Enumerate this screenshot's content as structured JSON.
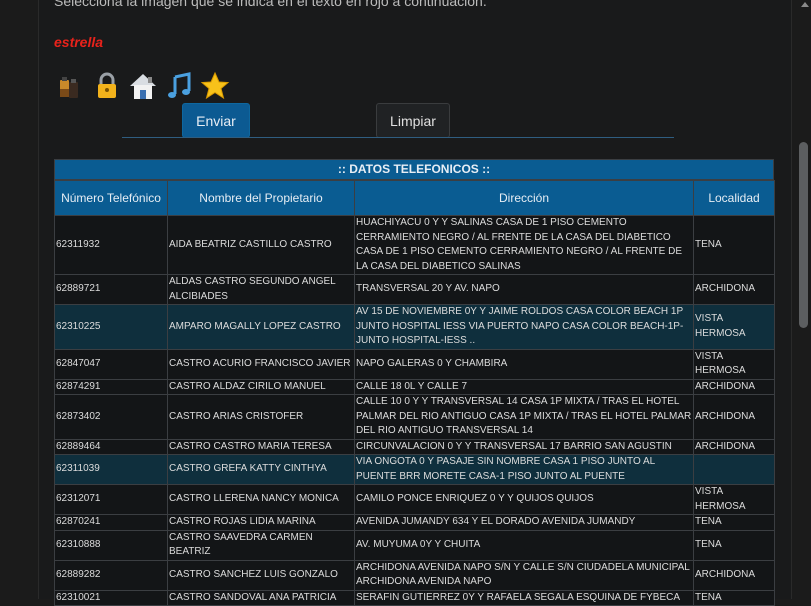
{
  "instruction": "Selecciona la imagen que se indica en el texto en rojo a continuación.",
  "target_word": "estrella",
  "icons": [
    "battery-icon",
    "lock-icon",
    "house-icon",
    "music-note-icon",
    "star-icon"
  ],
  "buttons": {
    "send": "Enviar",
    "clear": "Limpiar"
  },
  "table": {
    "title": ":: DATOS TELEFONICOS ::",
    "headers": [
      "Número Telefónico",
      "Nombre del Propietario",
      "Dirección",
      "Localidad"
    ],
    "rows": [
      [
        "62311932",
        "AIDA BEATRIZ CASTILLO CASTRO",
        "HUACHIYACU 0 Y Y SALINAS CASA DE 1 PISO CEMENTO CERRAMIENTO NEGRO / AL FRENTE DE LA CASA DEL DIABETICO CASA DE 1 PISO CEMENTO CERRAMIENTO NEGRO / AL FRENTE DE LA CASA DEL DIABETICO SALINAS",
        "TENA"
      ],
      [
        "62889721",
        "ALDAS CASTRO SEGUNDO ANGEL ALCIBIADES",
        "TRANSVERSAL 20 Y AV. NAPO",
        "ARCHIDONA"
      ],
      [
        "62310225",
        "AMPARO MAGALLY LOPEZ CASTRO",
        "AV 15 DE NOVIEMBRE 0Y Y JAIME ROLDOS CASA COLOR BEACH 1P JUNTO HOSPITAL IESS VIA PUERTO NAPO CASA COLOR BEACH-1P-JUNTO HOSPITAL-IESS ..",
        "VISTA HERMOSA"
      ],
      [
        "62847047",
        "CASTRO ACURIO FRANCISCO JAVIER",
        "NAPO GALERAS 0 Y CHAMBIRA",
        "VISTA HERMOSA"
      ],
      [
        "62874291",
        "CASTRO ALDAZ CIRILO MANUEL",
        "CALLE 18 0L Y CALLE 7",
        "ARCHIDONA"
      ],
      [
        "62873402",
        "CASTRO ARIAS CRISTOFER",
        "CALLE 10 0 Y Y TRANSVERSAL 14 CASA 1P MIXTA / TRAS EL HOTEL PALMAR DEL RIO ANTIGUO CASA 1P MIXTA / TRAS EL HOTEL PALMAR DEL RIO ANTIGUO TRANSVERSAL 14",
        "ARCHIDONA"
      ],
      [
        "62889464",
        "CASTRO CASTRO MARIA TERESA",
        "CIRCUNVALACION 0 Y Y TRANSVERSAL 17 BARRIO SAN AGUSTIN",
        "ARCHIDONA"
      ],
      [
        "62311039",
        "CASTRO GREFA KATTY CINTHYA",
        "VIA ONGOTA 0 Y PASAJE SIN NOMBRE CASA 1 PISO JUNTO AL PUENTE BRR MORETE CASA-1 PISO JUNTO AL PUENTE",
        ""
      ],
      [
        "62312071",
        "CASTRO LLERENA NANCY MONICA",
        "CAMILO PONCE ENRIQUEZ 0 Y Y QUIJOS QUIJOS",
        "VISTA HERMOSA"
      ],
      [
        "62870241",
        "CASTRO ROJAS LIDIA MARINA",
        "AVENIDA JUMANDY 634 Y EL DORADO AVENIDA JUMANDY",
        "TENA"
      ],
      [
        "62310888",
        "CASTRO SAAVEDRA CARMEN BEATRIZ",
        "AV. MUYUMA 0Y Y CHUITA",
        "TENA"
      ],
      [
        "62889282",
        "CASTRO SANCHEZ LUIS GONZALO",
        "ARCHIDONA AVENIDA NAPO S/N Y CALLE S/N CIUDADELA MUNICIPAL ARCHIDONA AVENIDA NAPO",
        "ARCHIDONA"
      ],
      [
        "62310021",
        "CASTRO SANDOVAL ANA PATRICIA",
        "SERAFIN GUTIERREZ 0Y Y RAFAELA SEGALA ESQUINA DE FYBECA",
        "TENA"
      ]
    ]
  },
  "highlighted_rows": [
    2,
    7
  ]
}
